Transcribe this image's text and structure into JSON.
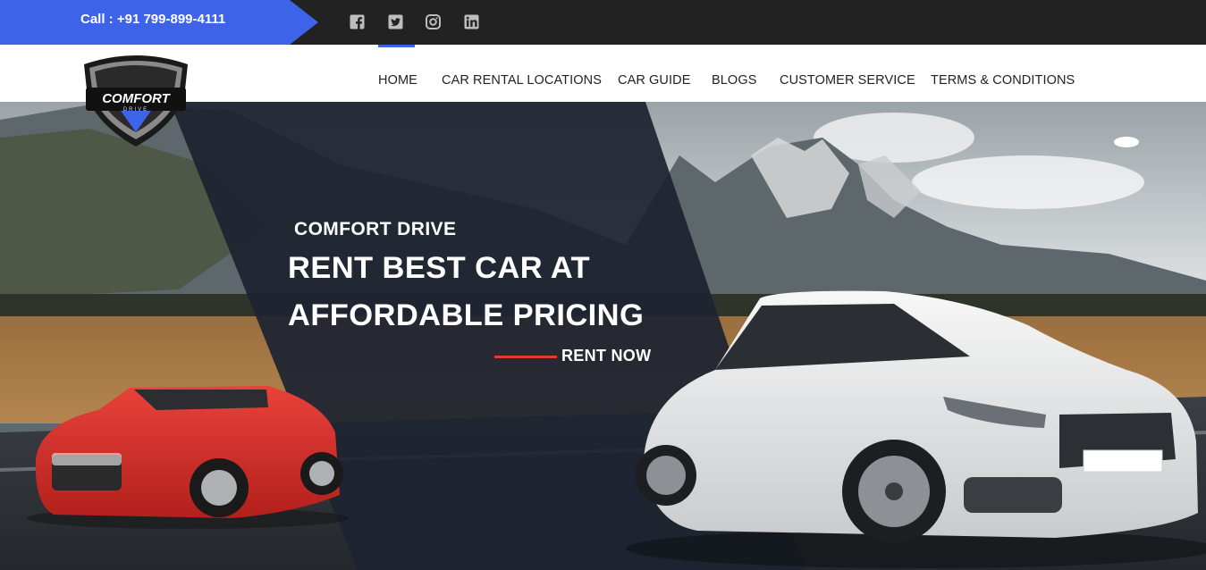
{
  "topbar": {
    "call_text": "Call : +91 799-899-4111",
    "accent_color": "#3d64e8",
    "social_icons": [
      "facebook-icon",
      "twitter-icon",
      "instagram-icon",
      "linkedin-icon"
    ]
  },
  "brand": {
    "logo_text": "COMFORT",
    "logo_subtext": "DRIVE"
  },
  "nav": {
    "items": [
      {
        "label": "HOME",
        "active": true
      },
      {
        "label": "CAR RENTAL LOCATIONS"
      },
      {
        "label": "CAR GUIDE"
      },
      {
        "label": "BLOGS"
      },
      {
        "label": "CUSTOMER SERVICE"
      },
      {
        "label": "TERMS & CONDITIONS"
      }
    ]
  },
  "hero": {
    "subtitle": "COMFORT DRIVE",
    "title_line1": "RENT BEST CAR AT",
    "title_line2": "AFFORDABLE PRICING",
    "cta": "RENT NOW",
    "cta_accent_color": "#e23c30",
    "panel_color": "#1d2430"
  }
}
